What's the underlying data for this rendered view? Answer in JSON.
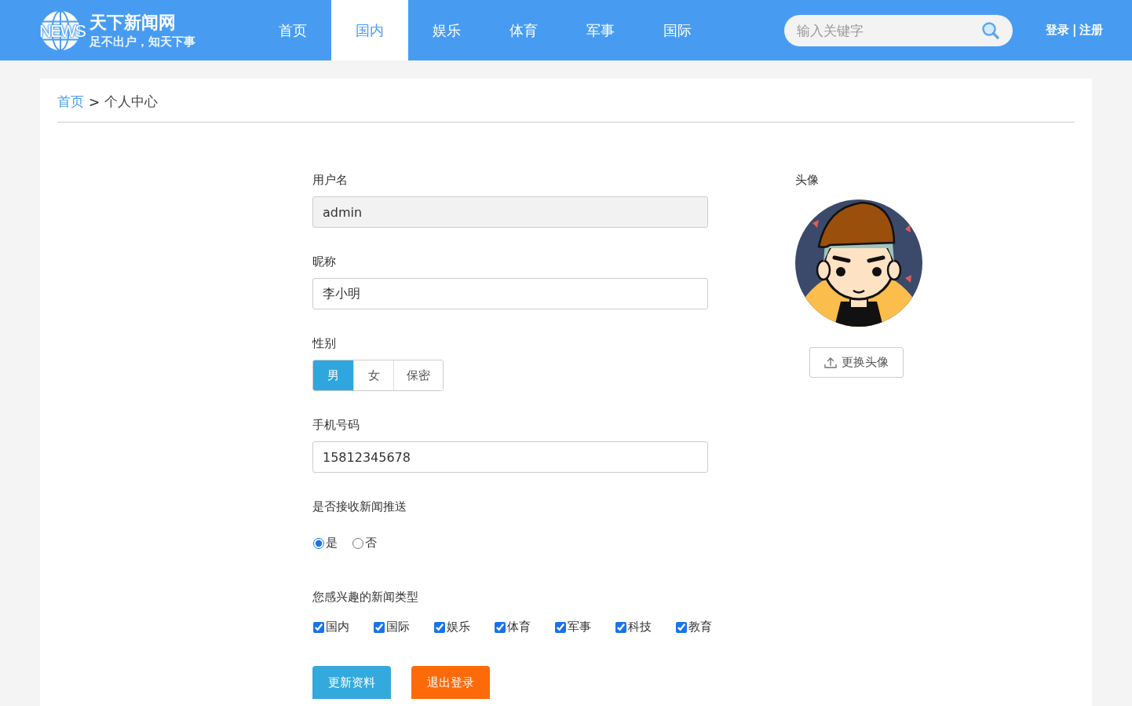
{
  "header": {
    "logo_mark": "NEWS",
    "title": "天下新闻网",
    "slogan": "足不出户，知天下事",
    "nav": [
      {
        "label": "首页",
        "selected": false
      },
      {
        "label": "国内",
        "selected": true
      },
      {
        "label": "娱乐",
        "selected": false
      },
      {
        "label": "体育",
        "selected": false
      },
      {
        "label": "军事",
        "selected": false
      },
      {
        "label": "国际",
        "selected": false
      }
    ],
    "search": {
      "placeholder": "输入关键字"
    },
    "auth": {
      "login": "登录",
      "separator": "|",
      "register": "注册"
    }
  },
  "breadcrumb": {
    "items": [
      {
        "label": "首页",
        "kind": "link"
      },
      {
        "label": "个人中心",
        "kind": "current"
      }
    ],
    "separator": ">"
  },
  "form": {
    "fields": [
      {
        "kind": "input",
        "label": "用户名",
        "value": "admin",
        "disabled": true
      },
      {
        "kind": "input",
        "label": "昵称",
        "value": "李小明",
        "disabled": false
      },
      {
        "kind": "segmented",
        "label": "性别",
        "options": [
          {
            "label": "男",
            "selected": true
          },
          {
            "label": "女",
            "selected": false
          },
          {
            "label": "保密",
            "selected": false
          }
        ]
      },
      {
        "kind": "input",
        "label": "手机号码",
        "value": "15812345678",
        "disabled": false
      },
      {
        "kind": "radio",
        "label": "是否接收新闻推送",
        "options": [
          {
            "label": "是",
            "selected": true
          },
          {
            "label": "否",
            "selected": false
          }
        ]
      },
      {
        "kind": "checkbox",
        "label": "您感兴趣的新闻类型",
        "options": [
          {
            "label": "国内",
            "checked": true
          },
          {
            "label": "国际",
            "checked": true
          },
          {
            "label": "娱乐",
            "checked": true
          },
          {
            "label": "体育",
            "checked": true
          },
          {
            "label": "军事",
            "checked": true
          },
          {
            "label": "科技",
            "checked": true
          },
          {
            "label": "教育",
            "checked": true
          }
        ]
      }
    ],
    "buttons": [
      {
        "label": "更新资料",
        "kind": "primary"
      },
      {
        "label": "退出登录",
        "kind": "danger"
      }
    ]
  },
  "avatar": {
    "label": "头像",
    "button": "更换头像"
  }
}
